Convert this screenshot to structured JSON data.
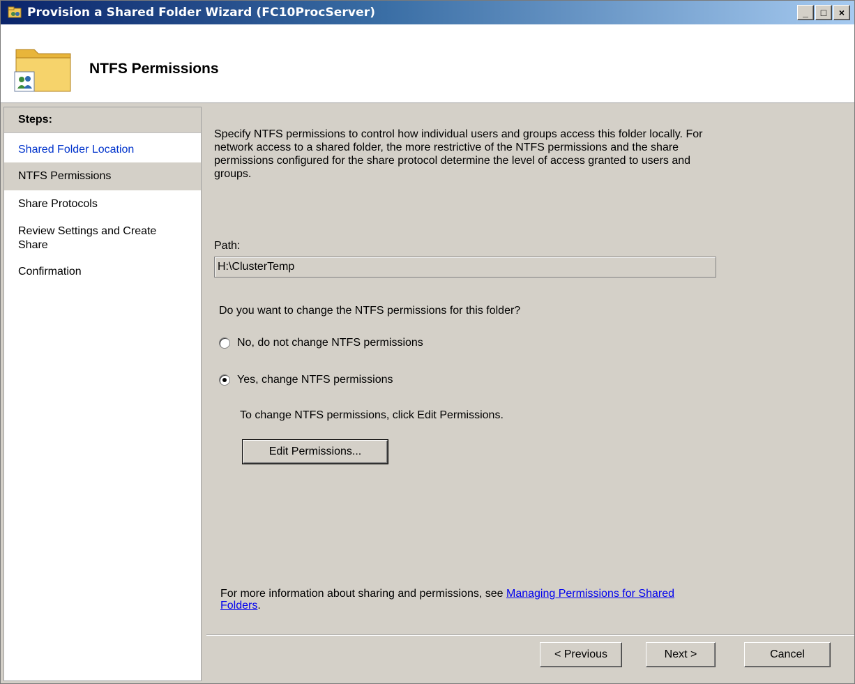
{
  "window": {
    "title": "Provision a Shared Folder Wizard (FC10ProcServer)",
    "minimize_glyph": "_",
    "maximize_glyph": "□",
    "close_glyph": "×"
  },
  "header": {
    "title": "NTFS Permissions",
    "icon": "shared-folder-users-icon"
  },
  "sidebar": {
    "heading": "Steps:",
    "items": [
      {
        "label": "Shared Folder Location",
        "state": "link"
      },
      {
        "label": "NTFS Permissions",
        "state": "current"
      },
      {
        "label": "Share Protocols",
        "state": "pending"
      },
      {
        "label": "Review Settings and Create Share",
        "state": "pending"
      },
      {
        "label": "Confirmation",
        "state": "pending"
      }
    ]
  },
  "main": {
    "description": "Specify NTFS permissions to control how individual users and groups access this folder locally. For network access to a shared folder, the more restrictive of the NTFS permissions and the share permissions configured for the share protocol determine the level of access granted to users and groups.",
    "path_label": "Path:",
    "path_value": "H:\\ClusterTemp",
    "question": "Do you want to change the NTFS permissions for this folder?",
    "radio_no": {
      "label": "No, do not change NTFS permissions",
      "checked": false
    },
    "radio_yes": {
      "label": "Yes, change NTFS permissions",
      "checked": true
    },
    "hint": "To change NTFS permissions, click Edit Permissions.",
    "edit_button": "Edit Permissions...",
    "info_prefix": "For more information about sharing and permissions, see ",
    "info_link": "Managing Permissions for Shared Folders",
    "info_suffix": "."
  },
  "buttons": {
    "previous": "< Previous",
    "next": "Next >",
    "cancel": "Cancel"
  },
  "colors": {
    "title_bar_start": "#0a246a",
    "title_bar_end": "#a6caf0",
    "link": "#0033cc",
    "dialog_face": "#d4d0c8"
  }
}
